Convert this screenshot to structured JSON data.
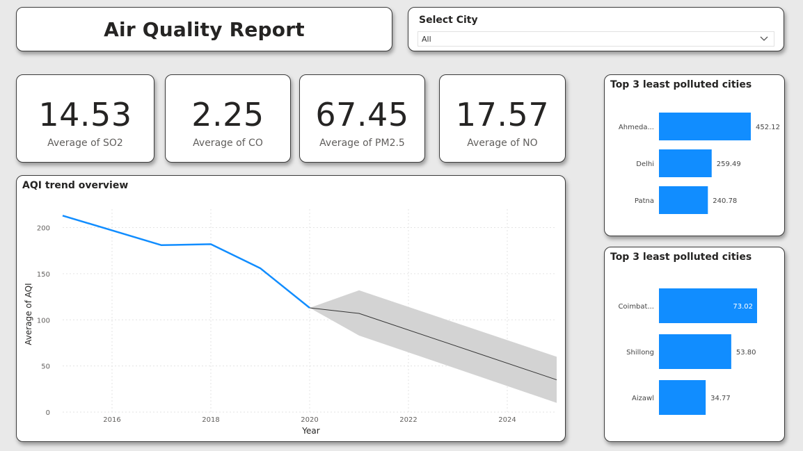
{
  "header": {
    "title": "Air Quality Report"
  },
  "slicer": {
    "label": "Select City",
    "value": "All"
  },
  "kpis": [
    {
      "value": "14.53",
      "label": "Average of SO2"
    },
    {
      "value": "2.25",
      "label": "Average of CO"
    },
    {
      "value": "67.45",
      "label": "Average of PM2.5"
    },
    {
      "value": "17.57",
      "label": "Average of NO"
    }
  ],
  "colors": {
    "accent": "#118dff",
    "forecast_band": "#d3d3d3",
    "forecast_line": "#333333",
    "card_border": "#3a3a3a",
    "background": "#e9e9e9"
  },
  "chart_data": [
    {
      "type": "line",
      "title": "AQI trend overview",
      "xlabel": "Year",
      "ylabel": "Average of AQI",
      "x_ticks": [
        2016,
        2018,
        2020,
        2022,
        2024
      ],
      "y_ticks": [
        0,
        50,
        100,
        150,
        200
      ],
      "xlim": [
        2015,
        2025
      ],
      "ylim": [
        0,
        220
      ],
      "grid": true,
      "series": [
        {
          "x": [
            2015,
            2017,
            2018,
            2019,
            2020
          ],
          "values": [
            213,
            181,
            182,
            156,
            113
          ]
        }
      ],
      "forecast": {
        "x": [
          2020,
          2021,
          2025
        ],
        "values": [
          113,
          107,
          35
        ],
        "upper": [
          113,
          132,
          60
        ],
        "lower": [
          113,
          83,
          10
        ]
      }
    },
    {
      "type": "bar",
      "orientation": "horizontal",
      "title": "Top 3 least polluted cities",
      "categories": [
        "Ahmeda...",
        "Delhi",
        "Patna"
      ],
      "values": [
        452.12,
        259.49,
        240.78
      ],
      "value_labels": [
        "452.12",
        "259.49",
        "240.78"
      ],
      "xlim": [
        0,
        452.12
      ]
    },
    {
      "type": "bar",
      "orientation": "horizontal",
      "title": "Top 3 least polluted cities",
      "categories": [
        "Coimbat...",
        "Shillong",
        "Aizawl"
      ],
      "values": [
        73.02,
        53.8,
        34.77
      ],
      "value_labels": [
        "73.02",
        "53.80",
        "34.77"
      ],
      "xlim": [
        0,
        73.02
      ]
    }
  ]
}
